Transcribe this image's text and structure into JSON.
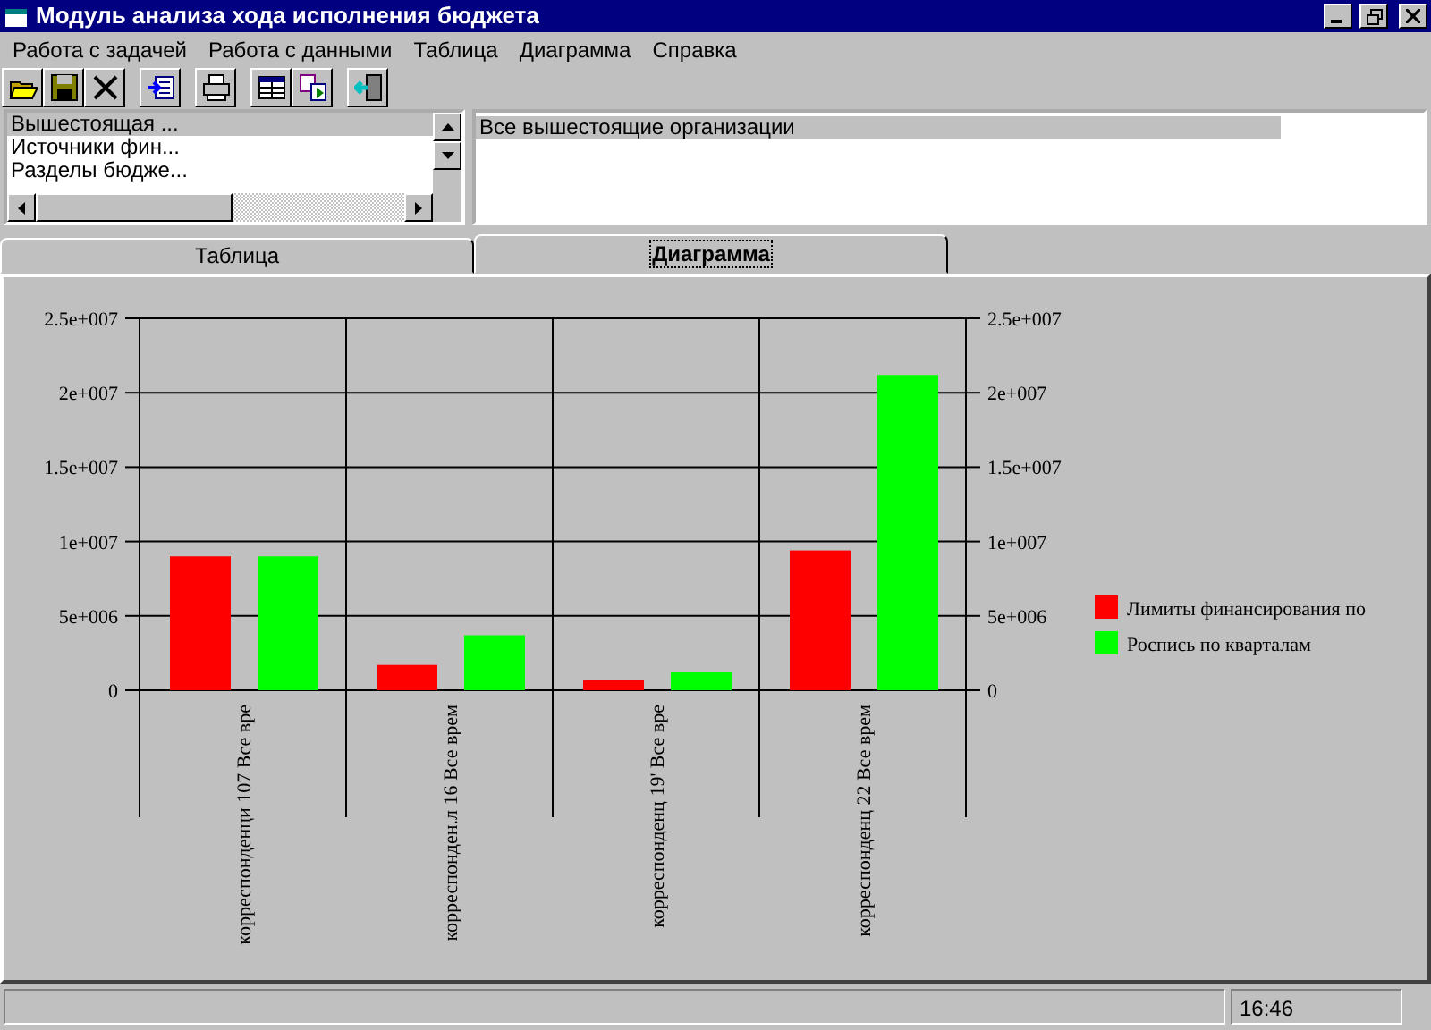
{
  "window": {
    "title": "Модуль анализа хода исполнения бюджета"
  },
  "menu": [
    "Работа с задачей",
    "Работа с данными",
    "Таблица",
    "Диаграмма",
    "Справка"
  ],
  "toolbar": [
    [
      {
        "kind": "open"
      },
      {
        "kind": "save"
      },
      {
        "kind": "delete"
      }
    ],
    [
      {
        "kind": "import"
      }
    ],
    [
      {
        "kind": "print"
      }
    ],
    [
      {
        "kind": "table"
      },
      {
        "kind": "chart"
      }
    ],
    [
      {
        "kind": "exit"
      }
    ]
  ],
  "dimension_list": [
    {
      "label": "Вышестоящая ...",
      "selected": true
    },
    {
      "label": "Источники фин...",
      "selected": false
    },
    {
      "label": "Разделы бюдже...",
      "selected": false
    }
  ],
  "value_list": [
    {
      "label": "Все вышестоящие организации",
      "selected": true
    }
  ],
  "tabs": [
    {
      "label": "Таблица",
      "selected": false
    },
    {
      "label": "Диаграмма",
      "selected": true
    }
  ],
  "chart": {
    "chart_data": {
      "type": "bar",
      "categories": [
        "корреспонденци 107 Все вре",
        "корреспонден.л 16 Все врем",
        "корреспонденц 19' Все вре",
        "корреспонденц 22 Все врем"
      ],
      "series": [
        {
          "name": "Лимиты финансирования по",
          "color": "#ff0000",
          "values": [
            9000000,
            1700000,
            700000,
            9400000
          ]
        },
        {
          "name": "Роспись по кварталам",
          "color": "#00ff00",
          "values": [
            9000000,
            3700000,
            1200000,
            21200000
          ]
        }
      ],
      "ylim": [
        0,
        25000000
      ],
      "grid": true,
      "legend": true,
      "yticks": [
        {
          "value": 0,
          "label": "0"
        },
        {
          "value": 5000000,
          "label": "5e+006"
        },
        {
          "value": 10000000,
          "label": "1e+007"
        },
        {
          "value": 15000000,
          "label": "1.5e+007"
        },
        {
          "value": 20000000,
          "label": "2e+007"
        },
        {
          "value": 25000000,
          "label": "2.5e+007"
        }
      ]
    }
  },
  "status_bar": {
    "time": "16:46"
  }
}
